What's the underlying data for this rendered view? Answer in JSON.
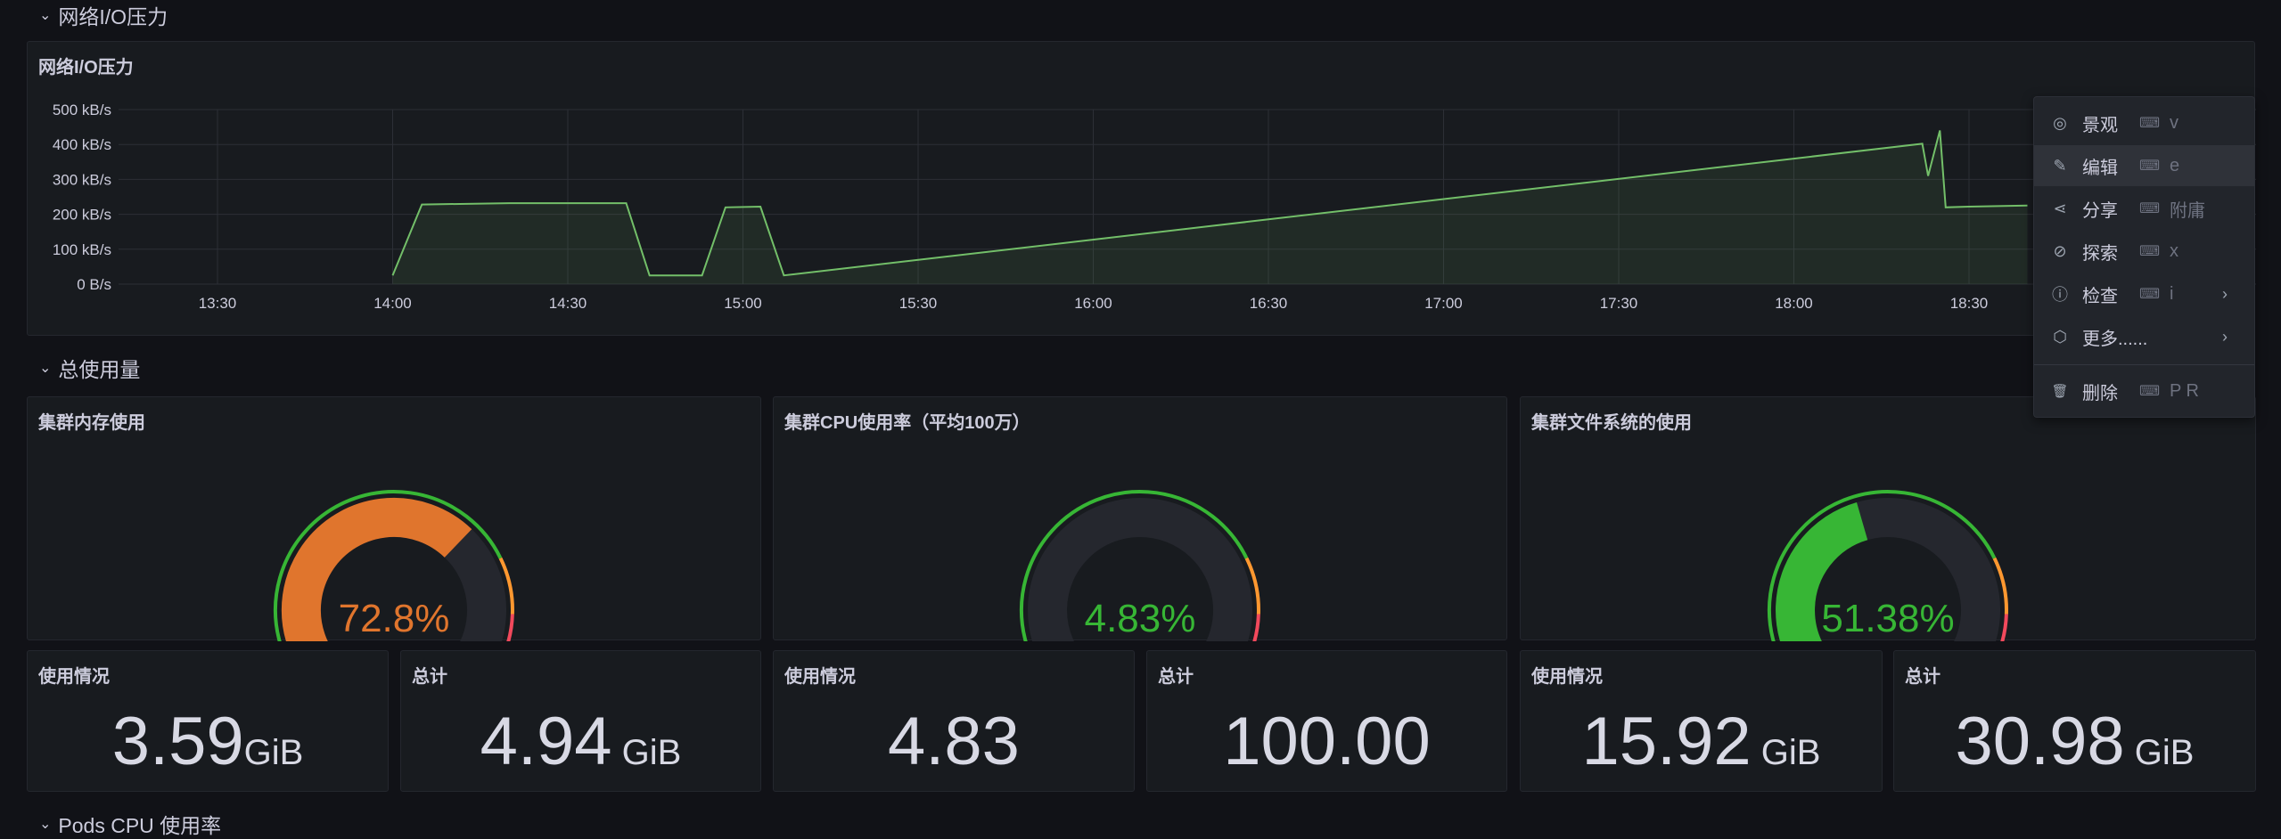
{
  "rows": {
    "network": "网络I/O压力",
    "total": "总使用量",
    "pods": "Pods CPU 使用率"
  },
  "network_panel": {
    "title": "网络I/O压力"
  },
  "chart_data": {
    "type": "area",
    "title": "网络I/O压力",
    "y_ticks": [
      "500 kB/s",
      "400 kB/s",
      "300 kB/s",
      "200 kB/s",
      "100 kB/s",
      "0 B/s"
    ],
    "x_ticks": [
      "13:30",
      "14:00",
      "14:30",
      "15:00",
      "15:30",
      "16:00",
      "16:30",
      "17:00",
      "17:30",
      "18:00",
      "18:30"
    ],
    "ylim": [
      0,
      500
    ],
    "series": [
      {
        "color": "#73bf69",
        "x": [
          "14:00",
          "14:05",
          "14:20",
          "14:40",
          "14:44",
          "14:53",
          "14:57",
          "15:03",
          "15:07",
          "18:22",
          "18:23",
          "18:25",
          "18:26",
          "18:30",
          "18:40"
        ],
        "values": [
          25,
          228,
          232,
          232,
          25,
          25,
          220,
          222,
          25,
          402,
          310,
          440,
          220,
          222,
          225
        ]
      }
    ]
  },
  "gauges": [
    {
      "title": "集群内存使用",
      "value": 72.8,
      "display": "72.8%",
      "color": "#e0752d"
    },
    {
      "title": "集群CPU使用率（平均100万）",
      "value": 4.83,
      "display": "4.83%",
      "color": "#37b635"
    },
    {
      "title": "集群文件系统的使用",
      "value": 51.38,
      "display": "51.38%",
      "color": "#37b635"
    }
  ],
  "stats": [
    {
      "title": "使用情况",
      "value": "3.59",
      "unit": "GiB"
    },
    {
      "title": "总计",
      "value": "4.94",
      "unit": " GiB"
    },
    {
      "title": "使用情况",
      "value": "4.83",
      "unit": ""
    },
    {
      "title": "总计",
      "value": "100.00",
      "unit": ""
    },
    {
      "title": "使用情况",
      "value": "15.92",
      "unit": " GiB"
    },
    {
      "title": "总计",
      "value": "30.98",
      "unit": " GiB"
    }
  ],
  "menu": [
    {
      "icon": "eye-icon",
      "glyph": "◎",
      "label": "景观",
      "key": "v",
      "arrow": false
    },
    {
      "icon": "edit-icon",
      "glyph": "✎",
      "label": "编辑",
      "key": "e",
      "arrow": false
    },
    {
      "icon": "share-icon",
      "glyph": "⋖",
      "label": "分享",
      "key": "附庸",
      "arrow": false
    },
    {
      "icon": "compass-icon",
      "glyph": "⊘",
      "label": "探索",
      "key": "x",
      "arrow": false
    },
    {
      "icon": "info-icon",
      "glyph": "ⓘ",
      "label": "检查",
      "key": "i",
      "arrow": true
    },
    {
      "icon": "cube-icon",
      "glyph": "⬡",
      "label": "更多......",
      "key": "",
      "arrow": true
    },
    {
      "icon": "trash-icon",
      "glyph": "🗑",
      "label": "删除",
      "key": "P R",
      "arrow": false
    }
  ],
  "colors": {
    "background": "#111217",
    "panel": "#181b1f",
    "green": "#73bf69",
    "orange": "#e0752d",
    "red": "#f2495c"
  }
}
